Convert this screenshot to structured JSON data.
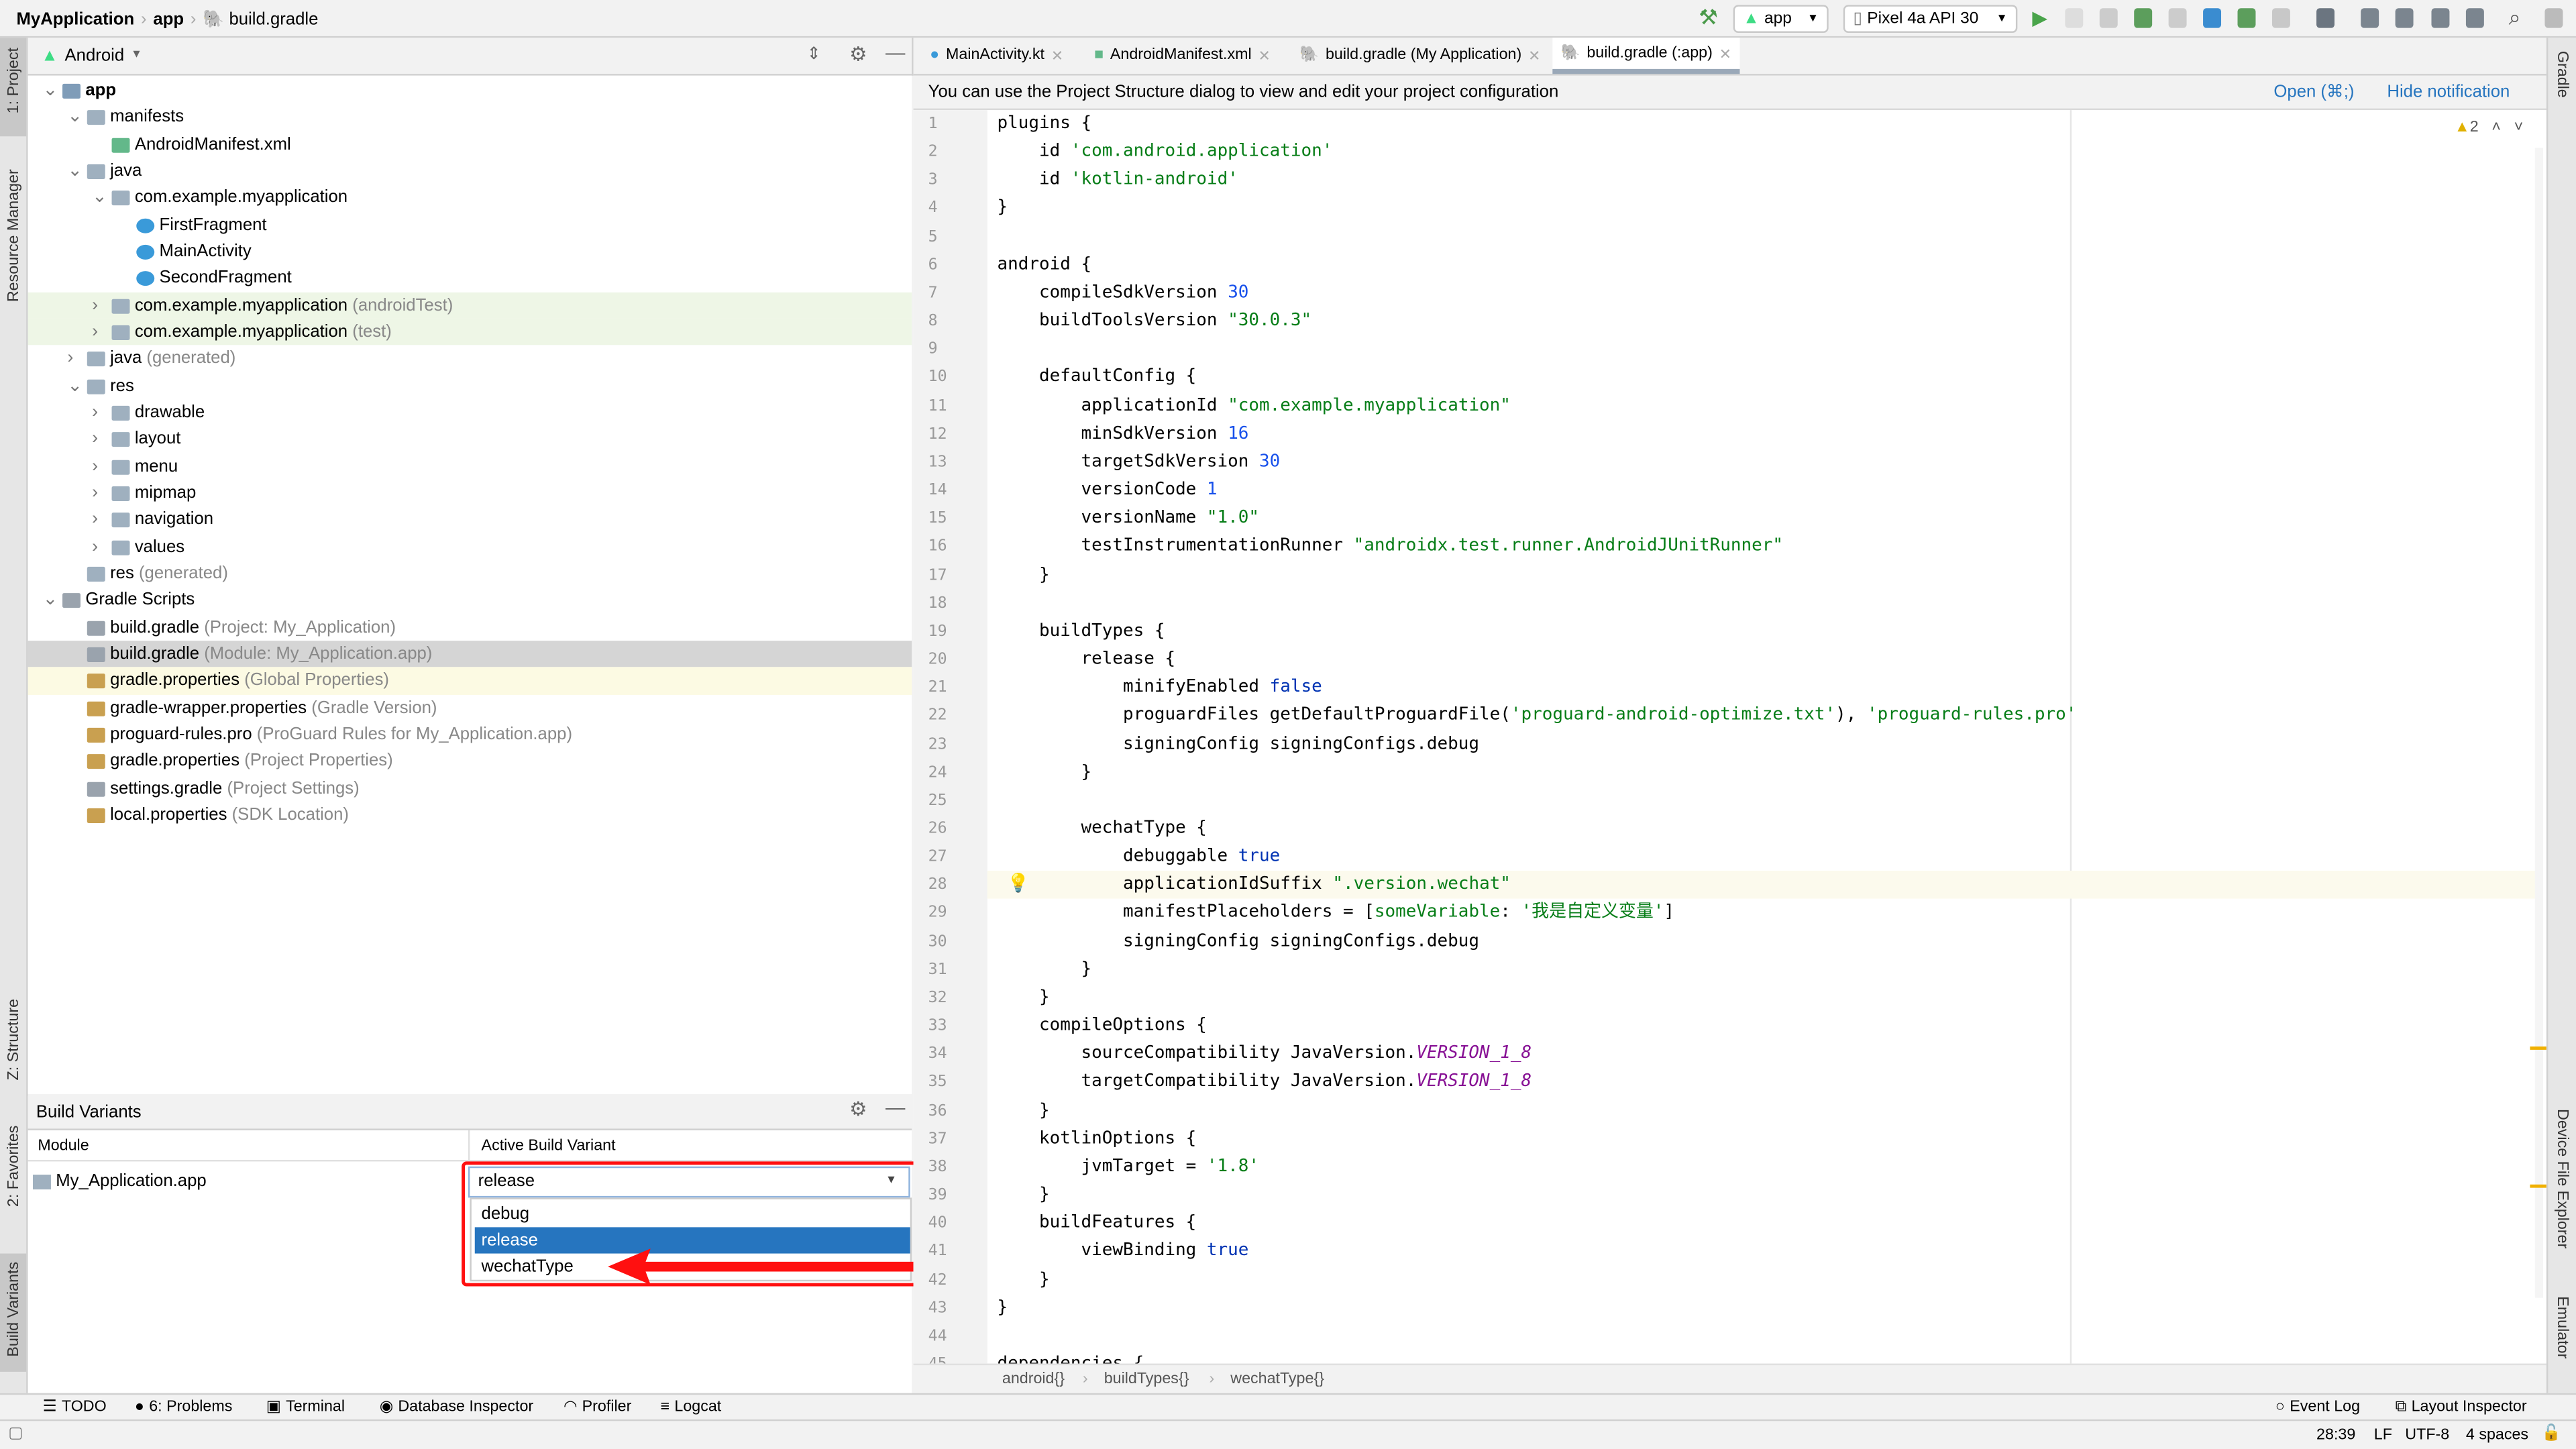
{
  "navbar": {
    "crumbs": [
      "MyApplication",
      "app",
      "build.gradle"
    ],
    "run_config": "app",
    "device": "Pixel 4a API 30"
  },
  "project_panel": {
    "view": "Android",
    "tree": [
      {
        "level": 0,
        "arrow": "open",
        "icon": "module",
        "label": "app",
        "bold": true
      },
      {
        "level": 1,
        "arrow": "open",
        "icon": "folder",
        "label": "manifests"
      },
      {
        "level": 2,
        "arrow": "none",
        "icon": "manifest",
        "label": "AndroidManifest.xml"
      },
      {
        "level": 1,
        "arrow": "open",
        "icon": "folder",
        "label": "java"
      },
      {
        "level": 2,
        "arrow": "open",
        "icon": "package",
        "label": "com.example.myapplication"
      },
      {
        "level": 3,
        "arrow": "none",
        "icon": "class",
        "label": "FirstFragment"
      },
      {
        "level": 3,
        "arrow": "none",
        "icon": "class",
        "label": "MainActivity"
      },
      {
        "level": 3,
        "arrow": "none",
        "icon": "class",
        "label": "SecondFragment"
      },
      {
        "level": 2,
        "arrow": "closed",
        "icon": "package",
        "label": "com.example.myapplication",
        "suffix": "(androidTest)",
        "bg": "#eef6e6"
      },
      {
        "level": 2,
        "arrow": "closed",
        "icon": "package",
        "label": "com.example.myapplication",
        "suffix": "(test)",
        "bg": "#eef6e6"
      },
      {
        "level": 1,
        "arrow": "closed",
        "icon": "folder",
        "label": "java",
        "suffix": "(generated)"
      },
      {
        "level": 1,
        "arrow": "open",
        "icon": "folder",
        "label": "res"
      },
      {
        "level": 2,
        "arrow": "closed",
        "icon": "folder",
        "label": "drawable"
      },
      {
        "level": 2,
        "arrow": "closed",
        "icon": "folder",
        "label": "layout"
      },
      {
        "level": 2,
        "arrow": "closed",
        "icon": "folder",
        "label": "menu"
      },
      {
        "level": 2,
        "arrow": "closed",
        "icon": "folder",
        "label": "mipmap"
      },
      {
        "level": 2,
        "arrow": "closed",
        "icon": "folder",
        "label": "navigation"
      },
      {
        "level": 2,
        "arrow": "closed",
        "icon": "folder",
        "label": "values"
      },
      {
        "level": 1,
        "arrow": "none",
        "icon": "folder",
        "label": "res",
        "suffix": "(generated)"
      },
      {
        "level": 0,
        "arrow": "open",
        "icon": "gradle",
        "label": "Gradle Scripts"
      },
      {
        "level": 1,
        "arrow": "none",
        "icon": "gradle",
        "label": "build.gradle",
        "suffix": "(Project: My_Application)"
      },
      {
        "level": 1,
        "arrow": "none",
        "icon": "gradle",
        "label": "build.gradle",
        "suffix": "(Module: My_Application.app)",
        "bg": "#d5d5d5"
      },
      {
        "level": 1,
        "arrow": "none",
        "icon": "props",
        "label": "gradle.properties",
        "suffix": "(Global Properties)",
        "bg": "#fcfae3"
      },
      {
        "level": 1,
        "arrow": "none",
        "icon": "props",
        "label": "gradle-wrapper.properties",
        "suffix": "(Gradle Version)"
      },
      {
        "level": 1,
        "arrow": "none",
        "icon": "props",
        "label": "proguard-rules.pro",
        "suffix": "(ProGuard Rules for My_Application.app)"
      },
      {
        "level": 1,
        "arrow": "none",
        "icon": "props",
        "label": "gradle.properties",
        "suffix": "(Project Properties)"
      },
      {
        "level": 1,
        "arrow": "none",
        "icon": "gradle",
        "label": "settings.gradle",
        "suffix": "(Project Settings)"
      },
      {
        "level": 1,
        "arrow": "none",
        "icon": "props",
        "label": "local.properties",
        "suffix": "(SDK Location)"
      }
    ]
  },
  "build_variants": {
    "title": "Build Variants",
    "col_module": "Module",
    "col_variant": "Active Build Variant",
    "module": "My_Application.app",
    "selected": "release",
    "options": [
      "debug",
      "release",
      "wechatType"
    ],
    "highlighted": "release"
  },
  "left_strip": [
    "1: Project",
    "Resource Manager",
    "Z: Structure",
    "2: Favorites",
    "Build Variants"
  ],
  "right_strip": [
    "Gradle",
    "Device File Explorer",
    "Emulator"
  ],
  "tabs": [
    {
      "label": "MainActivity.kt"
    },
    {
      "label": "AndroidManifest.xml"
    },
    {
      "label": "build.gradle (My Application)"
    },
    {
      "label": "build.gradle (:app)",
      "active": true
    }
  ],
  "notification": {
    "text": "You can use the Project Structure dialog to view and edit your project configuration",
    "open": "Open (⌘;)",
    "hide": "Hide notification"
  },
  "inspections": {
    "warnings": "2"
  },
  "code": [
    [
      [
        "plugins {",
        ""
      ]
    ],
    [
      [
        "    id ",
        ""
      ],
      [
        "'com.android.application'",
        "s"
      ]
    ],
    [
      [
        "    id ",
        ""
      ],
      [
        "'kotlin-android'",
        "s"
      ]
    ],
    [
      [
        "}",
        ""
      ]
    ],
    [],
    [
      [
        "android {",
        ""
      ]
    ],
    [
      [
        "    compileSdkVersion ",
        ""
      ],
      [
        "30",
        "n"
      ]
    ],
    [
      [
        "    buildToolsVersion ",
        ""
      ],
      [
        "\"30.0.3\"",
        "s"
      ]
    ],
    [],
    [
      [
        "    defaultConfig {",
        ""
      ]
    ],
    [
      [
        "        applicationId ",
        ""
      ],
      [
        "\"com.example.myapplication\"",
        "s"
      ]
    ],
    [
      [
        "        minSdkVersion ",
        ""
      ],
      [
        "16",
        "n"
      ]
    ],
    [
      [
        "        targetSdkVersion ",
        ""
      ],
      [
        "30",
        "n"
      ]
    ],
    [
      [
        "        versionCode ",
        ""
      ],
      [
        "1",
        "n"
      ]
    ],
    [
      [
        "        versionName ",
        ""
      ],
      [
        "\"1.0\"",
        "s"
      ]
    ],
    [
      [
        "        testInstrumentationRunner ",
        ""
      ],
      [
        "\"androidx.test.runner.AndroidJUnitRunner\"",
        "s"
      ]
    ],
    [
      [
        "    }",
        ""
      ]
    ],
    [],
    [
      [
        "    buildTypes {",
        ""
      ]
    ],
    [
      [
        "        release {",
        ""
      ]
    ],
    [
      [
        "            minifyEnabled ",
        ""
      ],
      [
        "false",
        "b"
      ]
    ],
    [
      [
        "            proguardFiles getDefaultProguardFile(",
        ""
      ],
      [
        "'proguard-android-optimize.txt'",
        "s"
      ],
      [
        "), ",
        ""
      ],
      [
        "'proguard-rules.pro'",
        "s"
      ]
    ],
    [
      [
        "            signingConfig signingConfigs.debug",
        ""
      ]
    ],
    [
      [
        "        }",
        ""
      ]
    ],
    [],
    [
      [
        "        wechatType {",
        ""
      ]
    ],
    [
      [
        "            debuggable ",
        ""
      ],
      [
        "true",
        "b"
      ]
    ],
    [
      [
        "            applicationIdSuffix ",
        ""
      ],
      [
        "\".version.wechat\"",
        "s"
      ]
    ],
    [
      [
        "            manifestPlaceholders = [",
        ""
      ],
      [
        "someVariable",
        "s"
      ],
      [
        ": ",
        ""
      ],
      [
        "'我是自定义变量'",
        "s"
      ],
      [
        "]",
        ""
      ]
    ],
    [
      [
        "            signingConfig signingConfigs.debug",
        ""
      ]
    ],
    [
      [
        "        }",
        ""
      ]
    ],
    [
      [
        "    }",
        ""
      ]
    ],
    [
      [
        "    compileOptions {",
        ""
      ]
    ],
    [
      [
        "        sourceCompatibility JavaVersion.",
        ""
      ],
      [
        "VERSION_1_8",
        "c"
      ]
    ],
    [
      [
        "        targetCompatibility JavaVersion.",
        ""
      ],
      [
        "VERSION_1_8",
        "c"
      ]
    ],
    [
      [
        "    }",
        ""
      ]
    ],
    [
      [
        "    kotlinOptions {",
        ""
      ]
    ],
    [
      [
        "        jvmTarget = ",
        ""
      ],
      [
        "'1.8'",
        "s"
      ]
    ],
    [
      [
        "    }",
        ""
      ]
    ],
    [
      [
        "    buildFeatures {",
        ""
      ]
    ],
    [
      [
        "        viewBinding ",
        ""
      ],
      [
        "true",
        "b"
      ]
    ],
    [
      [
        "    }",
        ""
      ]
    ],
    [
      [
        "}",
        ""
      ]
    ],
    [],
    [
      [
        "dependencies {",
        ""
      ]
    ]
  ],
  "current_line": 28,
  "editor_breadcrumb": [
    "android{}",
    "buildTypes{}",
    "wechatType{}"
  ],
  "bottom_tools": [
    "TODO",
    "6: Problems",
    "Terminal",
    "Database Inspector",
    "Profiler",
    "Logcat"
  ],
  "bottom_tools_right": [
    "Event Log",
    "Layout Inspector"
  ],
  "status": {
    "position": "28:39",
    "line_sep": "LF",
    "encoding": "UTF-8",
    "indent": "4 spaces"
  },
  "colors": {
    "accent": "#2675bf",
    "selection": "#2675bf",
    "annotation": "#ff0000"
  }
}
